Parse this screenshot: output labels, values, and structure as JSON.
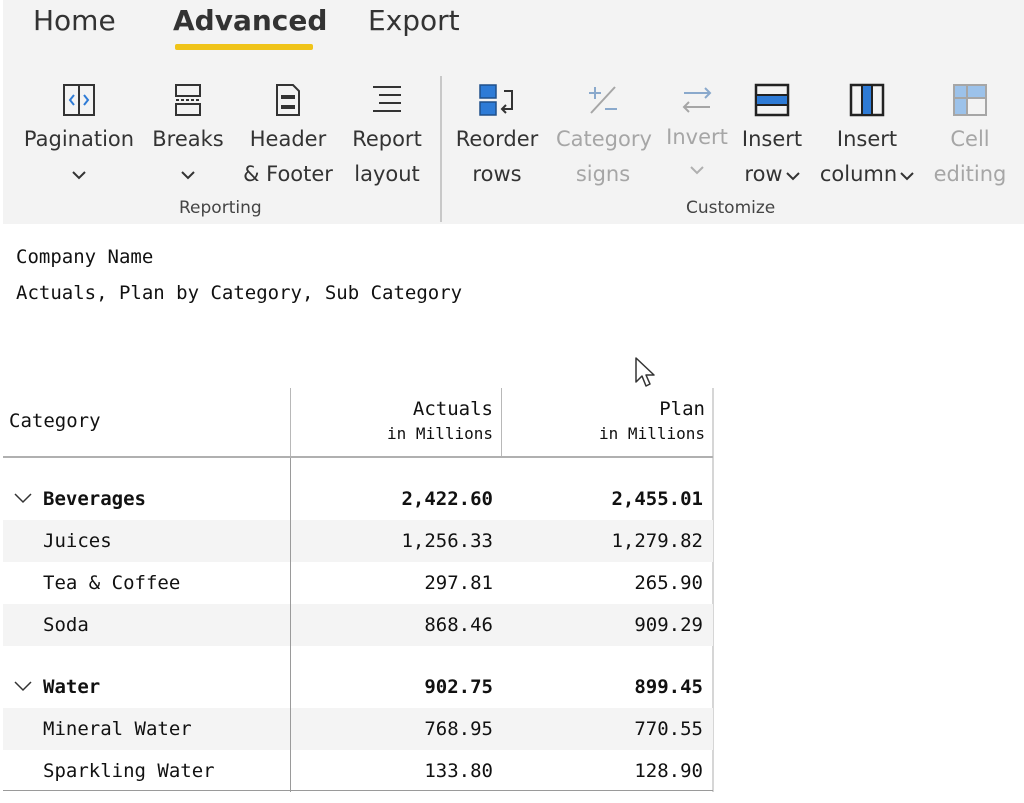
{
  "tabs": [
    {
      "label": "Home"
    },
    {
      "label": "Advanced"
    },
    {
      "label": "Export"
    }
  ],
  "ribbon": {
    "reporting_group_label": "Reporting",
    "customize_group_label": "Customize",
    "buttons": {
      "pagination": {
        "line1": "Pagination",
        "icon": "pagination-icon"
      },
      "breaks": {
        "line1": "Breaks",
        "icon": "breaks-icon"
      },
      "header_footer": {
        "line1": "Header",
        "line2": "& Footer",
        "icon": "header-footer-icon"
      },
      "report_layout": {
        "line1": "Report",
        "line2": "layout",
        "icon": "report-layout-icon"
      },
      "reorder_rows": {
        "line1": "Reorder",
        "line2": "rows",
        "icon": "reorder-rows-icon"
      },
      "category_signs": {
        "line1": "Category",
        "line2": "signs",
        "icon": "plus-minus-icon"
      },
      "invert": {
        "line1": "Invert",
        "icon": "invert-arrows-icon"
      },
      "insert_row": {
        "line1": "Insert",
        "line2": "row",
        "icon": "insert-row-icon"
      },
      "insert_column": {
        "line1": "Insert",
        "line2": "column",
        "icon": "insert-column-icon"
      },
      "cell_editing": {
        "line1": "Cell",
        "line2": "editing",
        "icon": "cell-editing-icon"
      }
    },
    "accent_color": "#2e7bd6",
    "active_tab_underline_color": "#f0c419"
  },
  "report": {
    "title": "Company Name",
    "subtitle": "Actuals, Plan by Category, Sub Category"
  },
  "table": {
    "columns": {
      "category": "Category",
      "actuals": "Actuals",
      "actuals_unit": "in Millions",
      "plan": "Plan",
      "plan_unit": "in Millions"
    },
    "groups": [
      {
        "name": "Beverages",
        "actuals": "2,422.60",
        "plan": "2,455.01",
        "rows": [
          {
            "name": "Juices",
            "actuals": "1,256.33",
            "plan": "1,279.82"
          },
          {
            "name": "Tea & Coffee",
            "actuals": "297.81",
            "plan": "265.90"
          },
          {
            "name": "Soda",
            "actuals": "868.46",
            "plan": "909.29"
          }
        ]
      },
      {
        "name": "Water",
        "actuals": "902.75",
        "plan": "899.45",
        "rows": [
          {
            "name": "Mineral Water",
            "actuals": "768.95",
            "plan": "770.55"
          },
          {
            "name": "Sparkling Water",
            "actuals": "133.80",
            "plan": "128.90"
          }
        ]
      }
    ]
  }
}
